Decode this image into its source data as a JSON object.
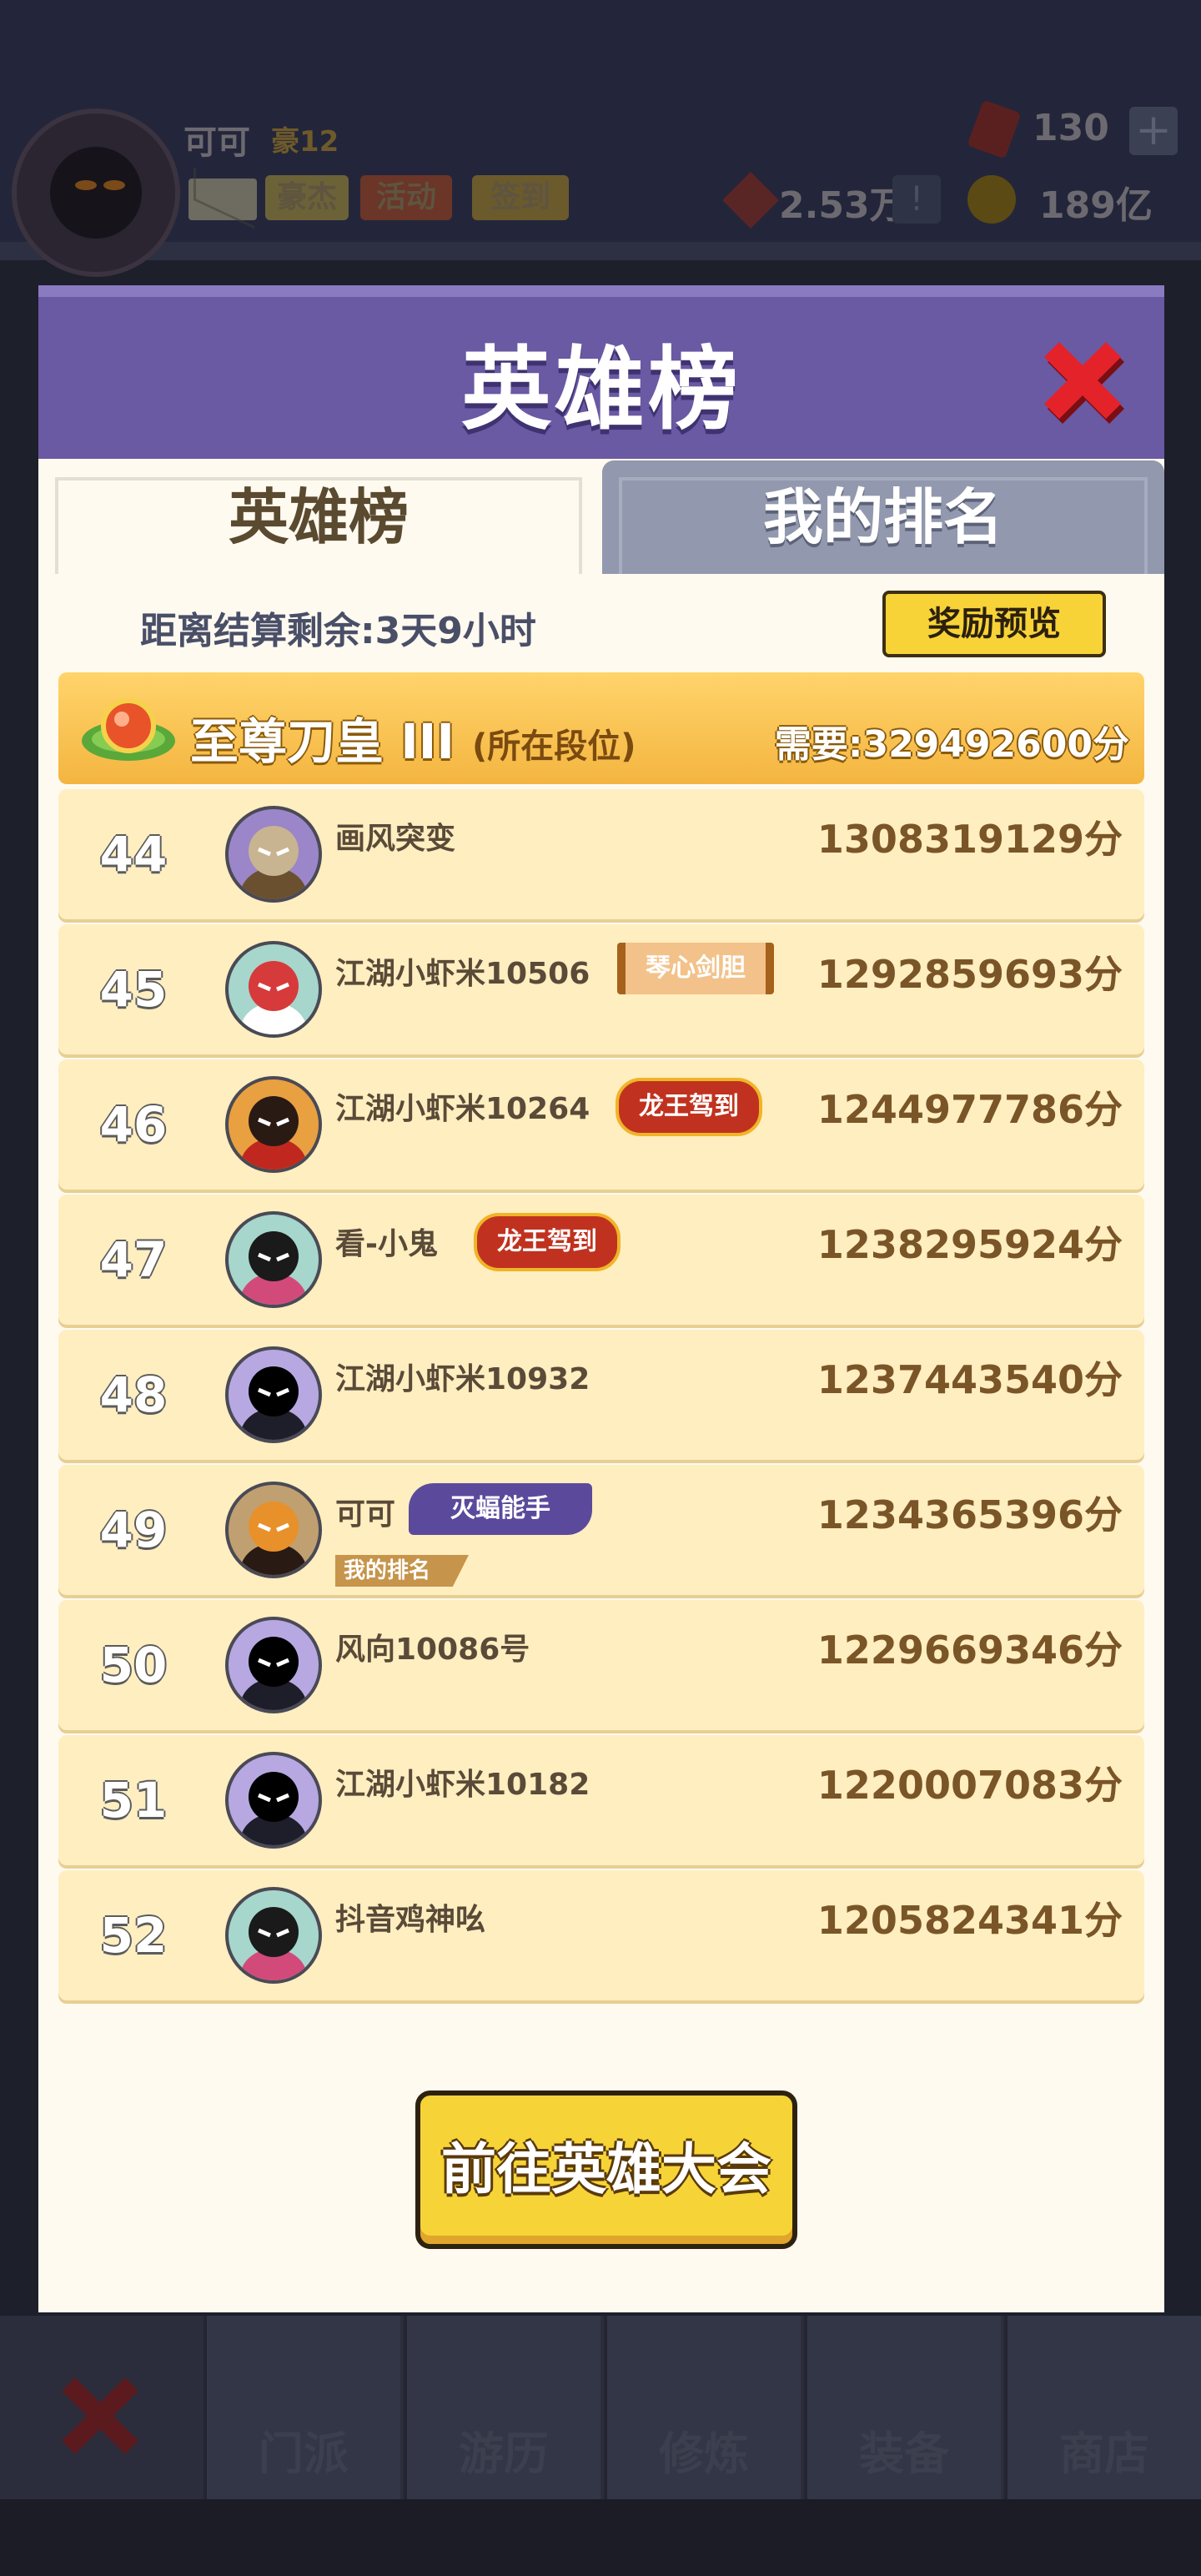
{
  "hud": {
    "player_name": "可可",
    "vip_level": "豪12",
    "buttons": [
      "豪杰",
      "活动",
      "签到"
    ],
    "gems": "130",
    "plus": "+",
    "rank_points": "2.53万",
    "rank_hint": "!",
    "coins": "189亿"
  },
  "modal": {
    "title": "英雄榜",
    "tabs": [
      "英雄榜",
      "我的排名"
    ],
    "active_tab": "英雄榜",
    "countdown": "距离结算剩余:3天9小时",
    "reward_preview": "奖励预览",
    "tier": {
      "name": "至尊刀皇 III",
      "note": "(所在段位)",
      "requirement": "需要:329492600分"
    },
    "rows": [
      {
        "rank": "44",
        "name": "画风突变",
        "score": "1308319129分",
        "badge": "",
        "badge_style": ""
      },
      {
        "rank": "45",
        "name": "江湖小虾米10506",
        "score": "1292859693分",
        "badge": "琴心剑胆",
        "badge_style": "scroll"
      },
      {
        "rank": "46",
        "name": "江湖小虾米10264",
        "score": "1244977786分",
        "badge": "龙王驾到",
        "badge_style": "dragon"
      },
      {
        "rank": "47",
        "name": "看-小鬼",
        "score": "1238295924分",
        "badge": "龙王驾到",
        "badge_style": "dragon"
      },
      {
        "rank": "48",
        "name": "江湖小虾米10932",
        "score": "1237443540分",
        "badge": "",
        "badge_style": ""
      },
      {
        "rank": "49",
        "name": "可可",
        "score": "1234365396分",
        "badge": "灭蝠能手",
        "badge_style": "bat",
        "tag": "我的排名"
      },
      {
        "rank": "50",
        "name": "风向10086号",
        "score": "1229669346分",
        "badge": "",
        "badge_style": ""
      },
      {
        "rank": "51",
        "name": "江湖小虾米10182",
        "score": "1220007083分",
        "badge": "",
        "badge_style": ""
      },
      {
        "rank": "52",
        "name": "抖音鸡神吆",
        "score": "1205824341分",
        "badge": "",
        "badge_style": ""
      }
    ],
    "go_button": "前往英雄大会"
  },
  "nav": {
    "tabs": [
      "门派",
      "游历",
      "修炼",
      "装备",
      "商店"
    ]
  },
  "colors": {
    "header": "#6a59a3",
    "row_bg": "#ffeec0",
    "tier_band": "#f4b540",
    "button_yellow": "#f6d437",
    "close_red": "#e4222a"
  }
}
